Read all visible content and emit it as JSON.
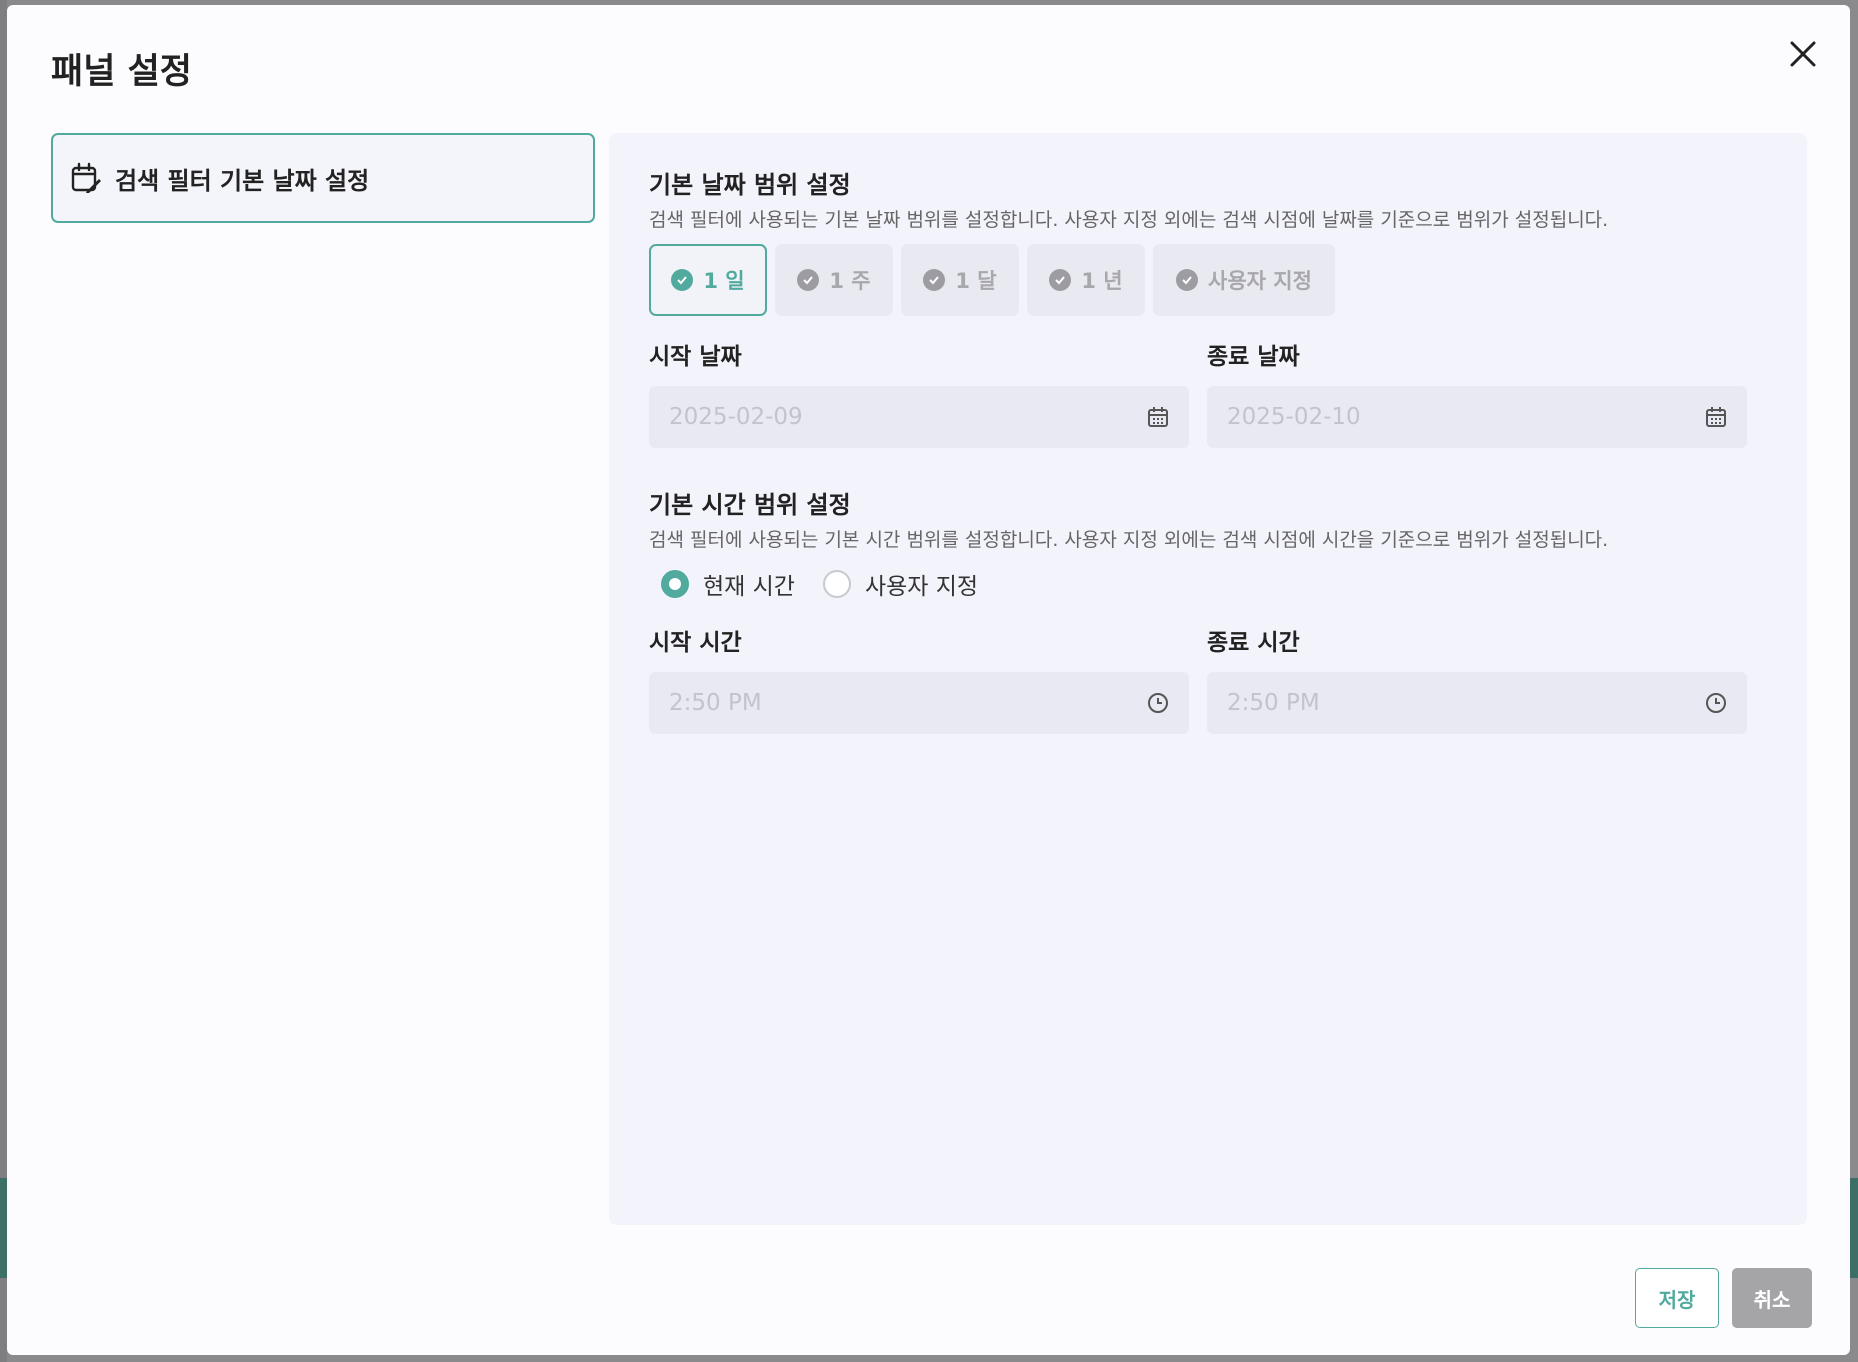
{
  "dialog": {
    "title": "패널 설정",
    "close_icon": "close-icon"
  },
  "sidebar": {
    "items": [
      {
        "label": "검색 필터 기본 날짜 설정",
        "icon": "calendar-edit-icon"
      }
    ]
  },
  "date_section": {
    "title": "기본 날짜 범위 설정",
    "description": "검색 필터에 사용되는 기본 날짜 범위를 설정합니다. 사용자 지정 외에는 검색 시점에 날짜를 기준으로 범위가 설정됩니다.",
    "ranges": [
      {
        "label": "1 일",
        "selected": true
      },
      {
        "label": "1 주",
        "selected": false
      },
      {
        "label": "1 달",
        "selected": false
      },
      {
        "label": "1 년",
        "selected": false
      },
      {
        "label": "사용자 지정",
        "selected": false
      }
    ],
    "start": {
      "label": "시작 날짜",
      "value": "2025-02-09"
    },
    "end": {
      "label": "종료 날짜",
      "value": "2025-02-10"
    }
  },
  "time_section": {
    "title": "기본 시간 범위 설정",
    "description": "검색 필터에 사용되는 기본 시간 범위를 설정합니다. 사용자 지정 외에는 검색 시점에 시간을 기준으로 범위가 설정됩니다.",
    "options": [
      {
        "label": "현재 시간",
        "selected": true
      },
      {
        "label": "사용자 지정",
        "selected": false
      }
    ],
    "start": {
      "label": "시작 시간",
      "value": "2:50 PM"
    },
    "end": {
      "label": "종료 시간",
      "value": "2:50 PM"
    }
  },
  "footer": {
    "save_label": "저장",
    "cancel_label": "취소"
  },
  "colors": {
    "accent": "#52aa9f",
    "panel_bg": "#f3f3fb",
    "field_bg": "#e9e9f3"
  }
}
